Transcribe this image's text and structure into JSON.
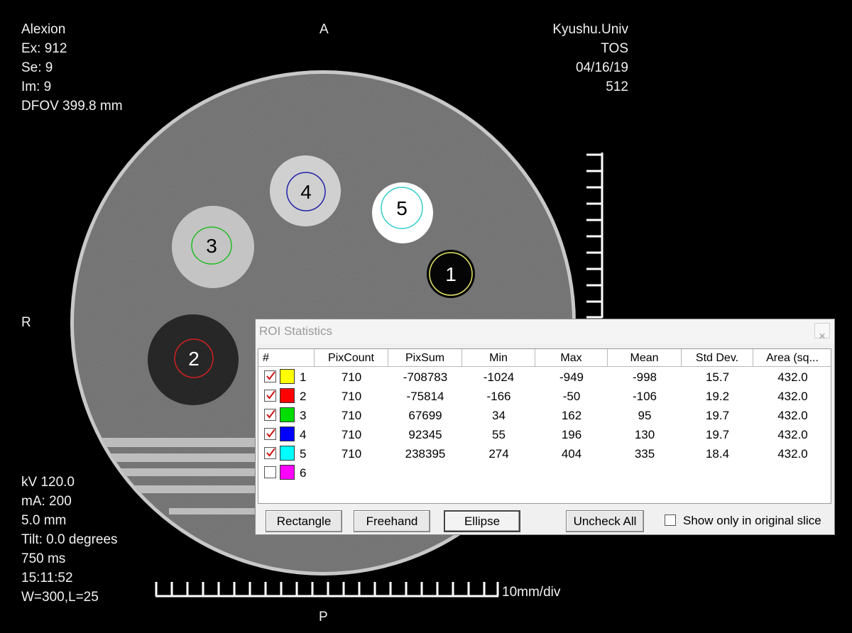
{
  "overlay": {
    "top_left": [
      "Alexion",
      "Ex: 912",
      "Se: 9",
      "Im: 9",
      "DFOV 399.8 mm"
    ],
    "top_right": [
      "Kyushu.Univ",
      "TOS",
      "04/16/19",
      "512"
    ],
    "bottom_left": [
      "kV 120.0",
      "mA:  200",
      "5.0 mm",
      "Tilt: 0.0 degrees",
      "750 ms",
      "15:11:52",
      "W=300,L=25"
    ],
    "orientation": {
      "top": "A",
      "bottom": "P",
      "left": "R"
    },
    "scale_label": "10mm/div"
  },
  "rois": [
    {
      "label": "1",
      "color": "#e6e66a"
    },
    {
      "label": "2",
      "color": "#d22020"
    },
    {
      "label": "3",
      "color": "#22bb22"
    },
    {
      "label": "4",
      "color": "#2222aa"
    },
    {
      "label": "5",
      "color": "#33cccc"
    }
  ],
  "dialog": {
    "title": "ROI Statistics",
    "close": "×",
    "columns": [
      "#",
      "PixCount",
      "PixSum",
      "Min",
      "Max",
      "Mean",
      "Std Dev.",
      "Area (sq..."
    ],
    "rows": [
      {
        "id": "1",
        "color": "#ffff00",
        "checked": true,
        "cells": [
          "710",
          "-708783",
          "-1024",
          "-949",
          "-998",
          "15.7",
          "432.0"
        ]
      },
      {
        "id": "2",
        "color": "#ff0000",
        "checked": true,
        "cells": [
          "710",
          "-75814",
          "-166",
          "-50",
          "-106",
          "19.2",
          "432.0"
        ]
      },
      {
        "id": "3",
        "color": "#00dd00",
        "checked": true,
        "cells": [
          "710",
          "67699",
          "34",
          "162",
          "95",
          "19.7",
          "432.0"
        ]
      },
      {
        "id": "4",
        "color": "#0000ff",
        "checked": true,
        "cells": [
          "710",
          "92345",
          "55",
          "196",
          "130",
          "19.7",
          "432.0"
        ]
      },
      {
        "id": "5",
        "color": "#00ffff",
        "checked": true,
        "cells": [
          "710",
          "238395",
          "274",
          "404",
          "335",
          "18.4",
          "432.0"
        ]
      },
      {
        "id": "6",
        "color": "#ff00ff",
        "checked": false,
        "cells": [
          "",
          "",
          "",
          "",
          "",
          "",
          ""
        ]
      }
    ],
    "buttons": {
      "rectangle": "Rectangle",
      "freehand": "Freehand",
      "ellipse": "Ellipse",
      "uncheck_all": "Uncheck All"
    },
    "option_label": "Show only in original slice",
    "option_checked": false
  }
}
